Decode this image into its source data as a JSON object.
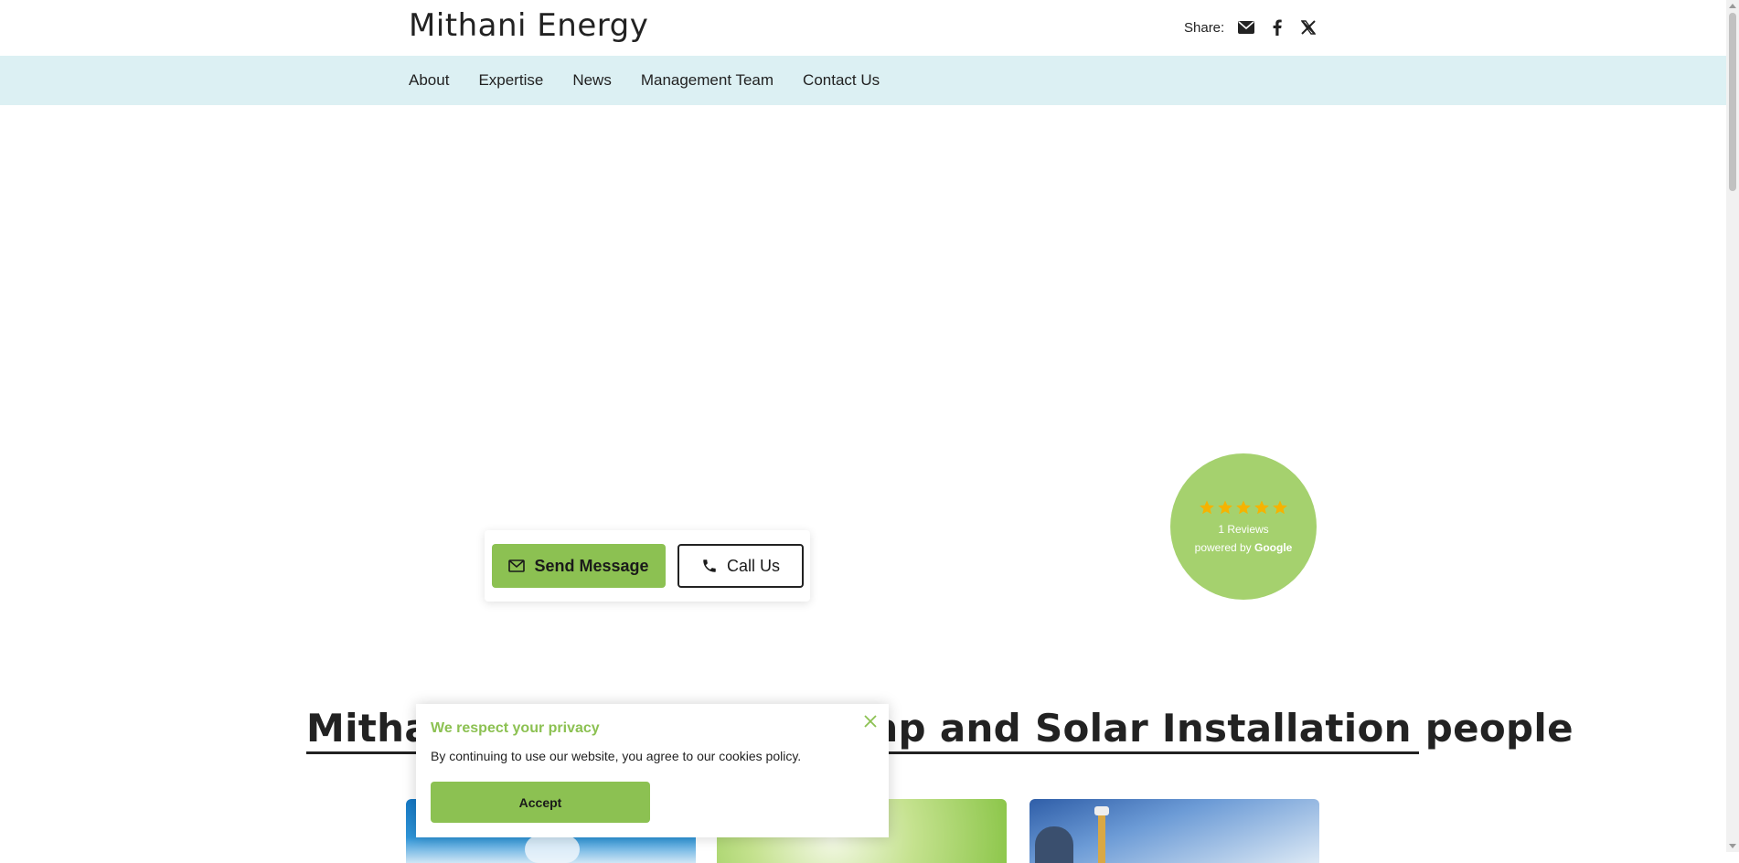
{
  "header": {
    "brand": "Mithani Energy",
    "share_label": "Share:"
  },
  "nav": {
    "items": [
      "About",
      "Expertise",
      "News",
      "Management Team",
      "Contact Us"
    ]
  },
  "cta": {
    "send_label": "Send Message",
    "call_label": "Call Us"
  },
  "reviews": {
    "rating": 5,
    "count_label": "1 Reviews",
    "powered_prefix": "powered by ",
    "powered_brand": "Google",
    "star_color": "#f5b301"
  },
  "main": {
    "heading": "Mithani Energy – Heat Pump and Solar Installation people"
  },
  "cookie": {
    "title": "We respect your privacy",
    "text": "By continuing to use our website, you agree to our cookies policy.",
    "accept_label": "Accept"
  },
  "colors": {
    "accent": "#8cc152",
    "nav_bg": "#dcf0f3",
    "badge_bg": "#a5d16e"
  }
}
